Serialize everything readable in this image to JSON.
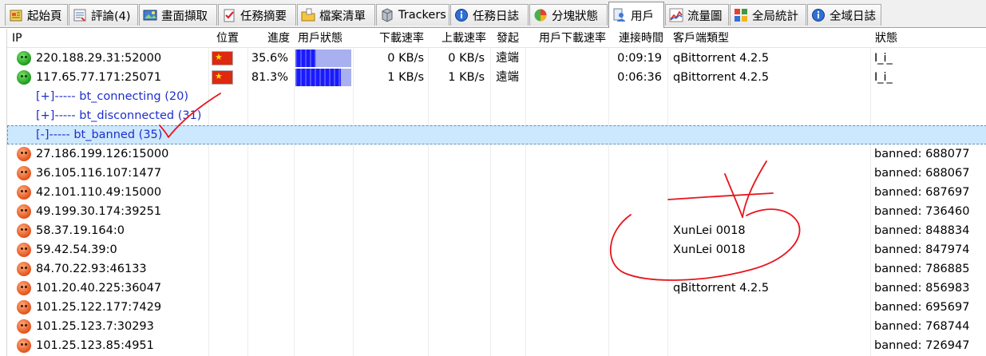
{
  "tabs": [
    {
      "label": "起始頁",
      "icon": "home-icon",
      "active": false
    },
    {
      "label": "評論(4)",
      "icon": "comment-icon",
      "active": false
    },
    {
      "label": "畫面擷取",
      "icon": "screenshot-icon",
      "active": false
    },
    {
      "label": "任務摘要",
      "icon": "checklist-icon",
      "active": false
    },
    {
      "label": "檔案清單",
      "icon": "folder-icon",
      "active": false
    },
    {
      "label": "Trackers",
      "icon": "server-icon",
      "active": false
    },
    {
      "label": "任務日誌",
      "icon": "info-icon",
      "active": false
    },
    {
      "label": "分塊狀態",
      "icon": "pie-chart-icon",
      "active": false
    },
    {
      "label": "用戶",
      "icon": "user-icon",
      "active": true
    },
    {
      "label": "流量圖",
      "icon": "line-chart-icon",
      "active": false
    },
    {
      "label": "全局統計",
      "icon": "stats-icon",
      "active": false
    },
    {
      "label": "全域日誌",
      "icon": "info-icon",
      "active": false
    }
  ],
  "columns": {
    "ip": "IP",
    "location": "位置",
    "progress": "進度",
    "user_status": "用戶狀態",
    "down_speed": "下載速率",
    "up_speed": "上載速率",
    "initiator": "發起",
    "peer_down_speed": "用戶下載速率",
    "connected_time": "連接時間",
    "client": "客戶端類型",
    "status": "狀態"
  },
  "connected_peers": [
    {
      "ip": "220.188.29.31:52000",
      "progress": "35.6%",
      "progress_value": 0.356,
      "down": "0 KB/s",
      "up": "0 KB/s",
      "initiator": "遠端",
      "peer_down": "",
      "time": "0:09:19",
      "client": "qBittorrent 4.2.5",
      "status": "I_i_"
    },
    {
      "ip": "117.65.77.171:25071",
      "progress": "81.3%",
      "progress_value": 0.813,
      "down": "1 KB/s",
      "up": "1 KB/s",
      "initiator": "遠端",
      "peer_down": "",
      "time": "0:06:36",
      "client": "qBittorrent 4.2.5",
      "status": "I_i_"
    }
  ],
  "groups": {
    "connecting": "[+]----- bt_connecting (20)",
    "disconnected": "[+]----- bt_disconnected (31)",
    "banned": "[-]----- bt_banned (35)"
  },
  "banned_peers": [
    {
      "ip": "27.186.199.126:15000",
      "client": "",
      "status": "banned: 688077"
    },
    {
      "ip": "36.105.116.107:1477",
      "client": "",
      "status": "banned: 688067"
    },
    {
      "ip": "42.101.110.49:15000",
      "client": "",
      "status": "banned: 687697"
    },
    {
      "ip": "49.199.30.174:39251",
      "client": "",
      "status": "banned: 736460"
    },
    {
      "ip": "58.37.19.164:0",
      "client": "XunLei 0018",
      "status": "banned: 848834"
    },
    {
      "ip": "59.42.54.39:0",
      "client": "XunLei 0018",
      "status": "banned: 847974"
    },
    {
      "ip": "84.70.22.93:46133",
      "client": "",
      "status": "banned: 786885"
    },
    {
      "ip": "101.20.40.225:36047",
      "client": "qBittorrent 4.2.5",
      "status": "banned: 856983"
    },
    {
      "ip": "101.25.122.177:7429",
      "client": "",
      "status": "banned: 695697"
    },
    {
      "ip": "101.25.123.7:30293",
      "client": "",
      "status": "banned: 768744"
    },
    {
      "ip": "101.25.123.85:4951",
      "client": "",
      "status": "banned: 726947"
    }
  ],
  "colors": {
    "selection": "#cce8ff",
    "group_text": "#1f2ecb",
    "annotation": "#e8141c",
    "progress_fill": "#1a1aff"
  }
}
